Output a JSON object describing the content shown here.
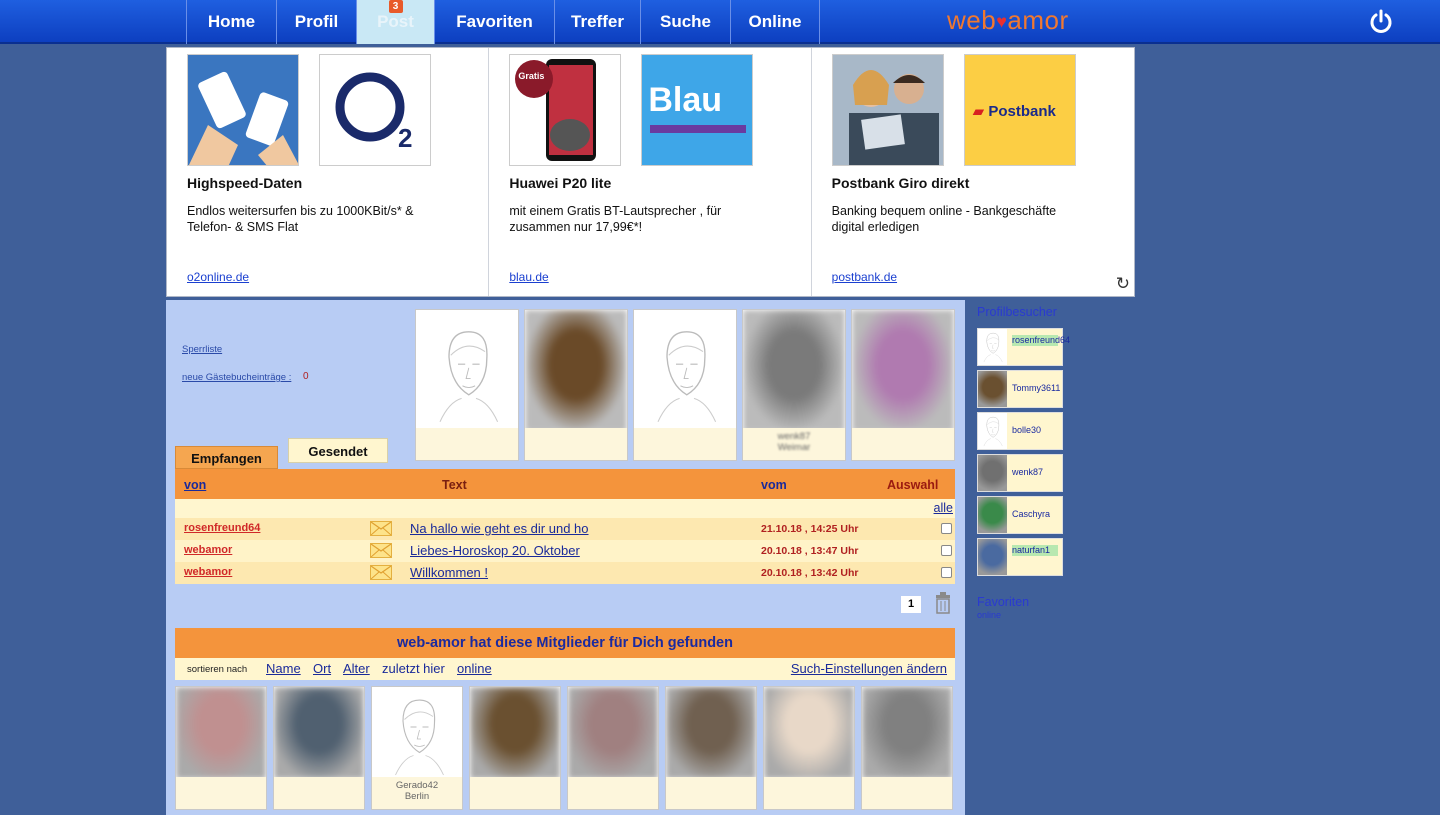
{
  "nav": {
    "items": [
      {
        "label": "Home",
        "width": 90
      },
      {
        "label": "Profil",
        "width": 80
      },
      {
        "label": "Post",
        "width": 78,
        "active": true,
        "badge": "3"
      },
      {
        "label": "Favoriten",
        "width": 120
      },
      {
        "label": "Treffer",
        "width": 86
      },
      {
        "label": "Suche",
        "width": 90
      },
      {
        "label": "Online",
        "width": 90
      }
    ],
    "logo_left": "web",
    "logo_right": "amor"
  },
  "ads": [
    {
      "title": "Highspeed-Daten",
      "text": "Endlos weitersurfen bis zu 1000KBit/s* & Telefon- & SMS Flat",
      "link": "o2online.de",
      "brand": "O2"
    },
    {
      "title": "Huawei P20 lite",
      "text": "mit einem Gratis BT-Lautsprecher , für zusammen nur 17,99€*!",
      "link": "blau.de",
      "brand": "Blau",
      "promo": "Gratis"
    },
    {
      "title": "Postbank Giro direkt",
      "text": "Banking bequem online - Bankgeschäfte digital erledigen",
      "link": "postbank.de",
      "brand": "Postbank"
    }
  ],
  "post": {
    "sperrliste": "Sperrliste",
    "guestbook_label": "neue Gästebucheinträge :",
    "guestbook_count": "0",
    "tab_received": "Empfangen",
    "tab_sent": "Gesendet",
    "col_from": "von",
    "col_text": "Text",
    "col_date": "vom",
    "col_select": "Auswahl",
    "select_all": "alle",
    "messages": [
      {
        "from": "rosenfreund64",
        "subject": "Na hallo wie geht es dir  und ho",
        "date": "21.10.18 , 14:25 Uhr"
      },
      {
        "from": "webamor",
        "subject": "Liebes-Horoskop 20. Oktober",
        "date": "20.10.18 , 13:47 Uhr"
      },
      {
        "from": "webamor",
        "subject": "Willkommen !",
        "date": "20.10.18 , 13:42 Uhr"
      }
    ],
    "page": "1"
  },
  "members": {
    "heading": "web-amor hat diese Mitglieder für Dich gefunden",
    "sort_label": "sortieren nach",
    "sort_name": "Name",
    "sort_ort": "Ort",
    "sort_alter": "Alter",
    "sort_zuletzt": "zuletzt hier",
    "sort_online": "online",
    "settings": "Such-Einstellungen ändern"
  },
  "top_cards": [
    {
      "caption": "",
      "photo": false
    },
    {
      "caption": "",
      "photo": true,
      "color": "#6a4a28"
    },
    {
      "caption": "",
      "photo": false
    },
    {
      "caption": "wenk87  ",
      "caption2": "Weimar",
      "photo": true,
      "color": "#7a7a7a"
    },
    {
      "caption": "",
      "photo": true,
      "color": "#b07ab0"
    }
  ],
  "bottom_cards": [
    {
      "photo": true,
      "color": "#c09090"
    },
    {
      "photo": true,
      "color": "#506070"
    },
    {
      "photo": false,
      "caption": "Gerado42",
      "caption2": "Berlin"
    },
    {
      "photo": true,
      "color": "#6a5030"
    },
    {
      "photo": true,
      "color": "#a08080"
    },
    {
      "photo": true,
      "color": "#706050"
    },
    {
      "photo": true,
      "color": "#e8d8c8"
    },
    {
      "photo": true,
      "color": "#808080"
    }
  ],
  "sidebar": {
    "visitors_title": "Profilbesucher",
    "visitors": [
      {
        "name": "rosenfreund64",
        "highlight": true,
        "photo": false
      },
      {
        "name": "Tommy3611",
        "highlight": false,
        "photo": true,
        "color": "#6a5030"
      },
      {
        "name": "bolle30",
        "highlight": false,
        "photo": false
      },
      {
        "name": "wenk87",
        "highlight": false,
        "photo": true,
        "color": "#707070"
      },
      {
        "name": "Caschyra",
        "highlight": false,
        "photo": true,
        "color": "#3a8a4a"
      },
      {
        "name": "naturfan1",
        "highlight": true,
        "photo": true,
        "color": "#4a6aa0"
      }
    ],
    "favorites_title": "Favoriten",
    "favorites_sub": "online"
  }
}
